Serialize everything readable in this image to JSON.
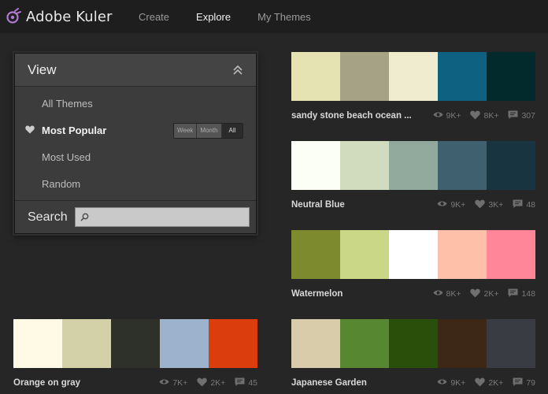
{
  "app": {
    "title": "Adobe Kuler"
  },
  "nav": [
    {
      "label": "Create",
      "active": false
    },
    {
      "label": "Explore",
      "active": true
    },
    {
      "label": "My Themes",
      "active": false
    }
  ],
  "view_panel": {
    "title": "View",
    "items": [
      {
        "label": "All Themes",
        "active": false
      },
      {
        "label": "Most Popular",
        "active": true
      },
      {
        "label": "Most Used",
        "active": false
      },
      {
        "label": "Random",
        "active": false
      }
    ],
    "range": [
      "Week",
      "Month",
      "All"
    ],
    "range_selected": "All",
    "search_label": "Search",
    "search_value": ""
  },
  "themes": [
    {
      "name": "sandy stone beach ocean ...",
      "colors": [
        "#e6e3b2",
        "#a6a285",
        "#efecd0",
        "#0e6181",
        "#022a2c"
      ],
      "views": "9K+",
      "likes": "8K+",
      "comments": "307"
    },
    {
      "name": "Neutral Blue",
      "colors": [
        "#fcfff5",
        "#d1dbbd",
        "#91aa9d",
        "#3e606f",
        "#193441"
      ],
      "views": "9K+",
      "likes": "3K+",
      "comments": "48"
    },
    {
      "name": "Watermelon",
      "colors": [
        "#7d8a2e",
        "#c9d787",
        "#ffffff",
        "#ffc0a9",
        "#ff8598"
      ],
      "views": "8K+",
      "likes": "2K+",
      "comments": "148"
    },
    {
      "name": "Orange on gray",
      "colors": [
        "#fffae6",
        "#d3d1a8",
        "#2e302a",
        "#9db3cd",
        "#db3e0c"
      ],
      "views": "7K+",
      "likes": "2K+",
      "comments": "45"
    },
    {
      "name": "Japanese Garden",
      "colors": [
        "#d9ccab",
        "#578730",
        "#2a4f0a",
        "#3d2818",
        "#393c43"
      ],
      "views": "9K+",
      "likes": "2K+",
      "comments": "79"
    }
  ]
}
